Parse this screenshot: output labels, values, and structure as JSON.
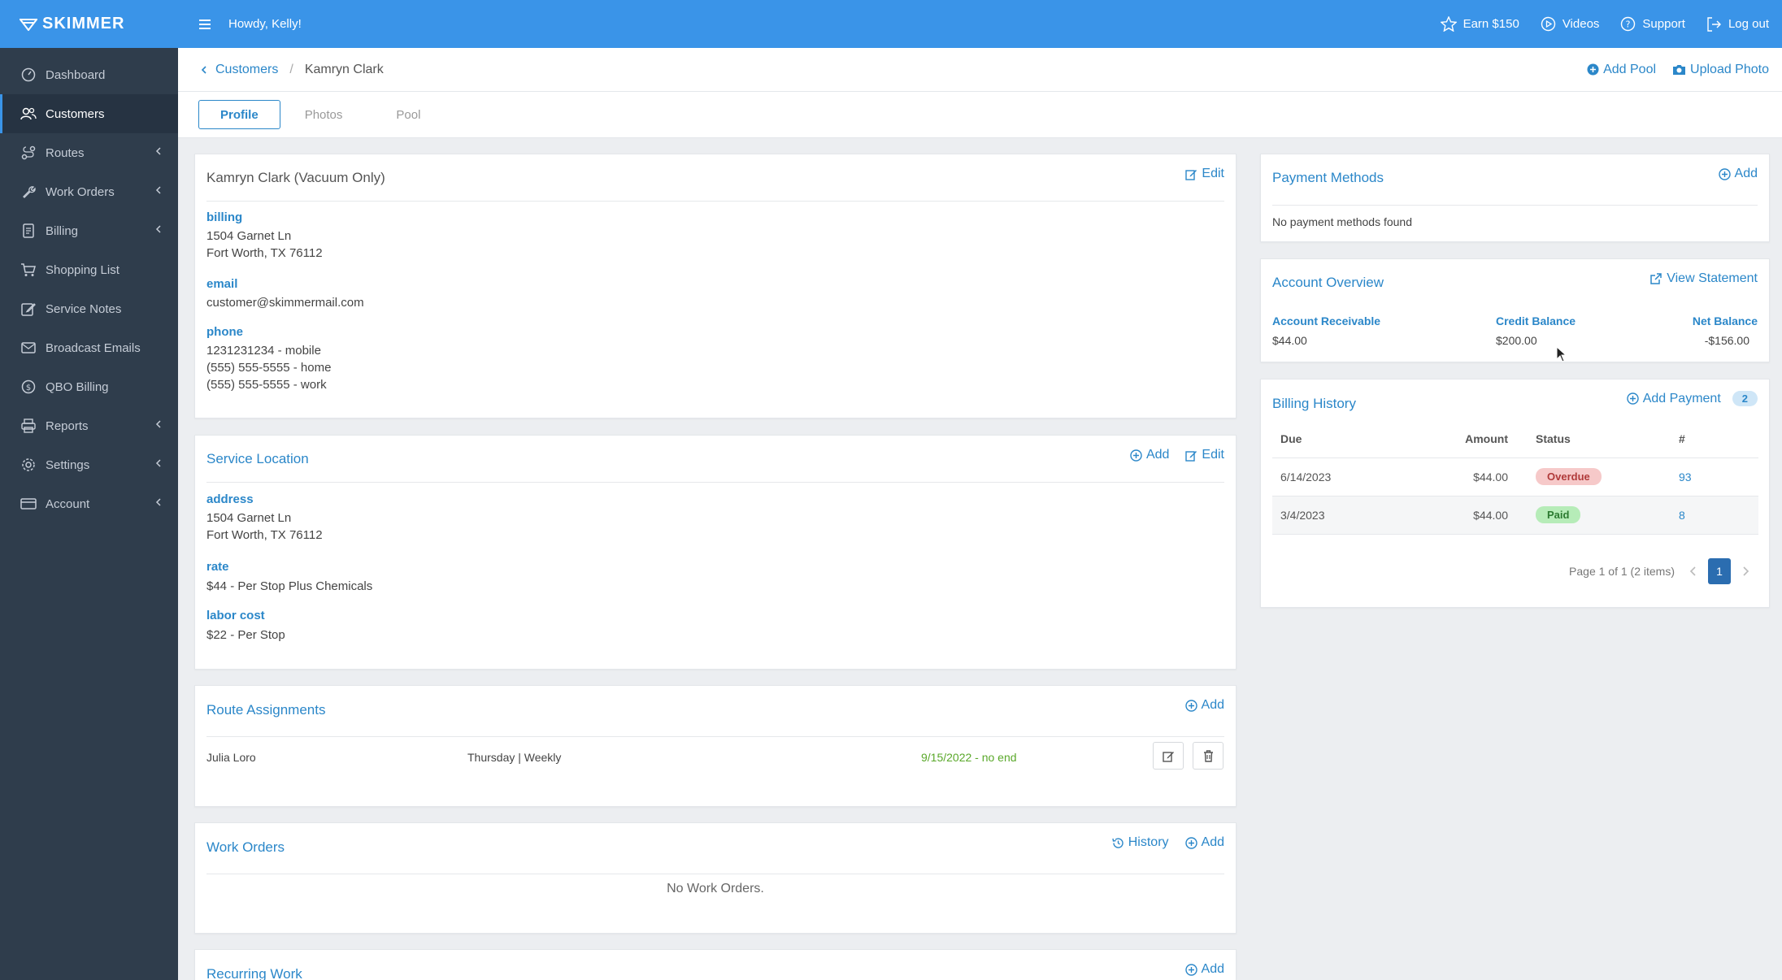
{
  "brand": "SKIMMER",
  "colors": {
    "primary": "#3a94e8",
    "sidebar": "#2f3d4c",
    "link": "#2b87c9",
    "overdue": "#f6c9c9",
    "paid": "#b6ecb8"
  },
  "sidebar": {
    "items": [
      {
        "label": "Dashboard",
        "icon": "dashboard-icon"
      },
      {
        "label": "Customers",
        "icon": "users-icon"
      },
      {
        "label": "Routes",
        "icon": "route-icon"
      },
      {
        "label": "Work Orders",
        "icon": "wrench-icon"
      },
      {
        "label": "Billing",
        "icon": "document-icon"
      },
      {
        "label": "Shopping List",
        "icon": "cart-icon"
      },
      {
        "label": "Service Notes",
        "icon": "note-icon"
      },
      {
        "label": "Broadcast Emails",
        "icon": "envelope-icon"
      },
      {
        "label": "QBO Billing",
        "icon": "dollar-icon"
      },
      {
        "label": "Reports",
        "icon": "printer-icon"
      },
      {
        "label": "Settings",
        "icon": "gear-icon"
      },
      {
        "label": "Account",
        "icon": "card-icon"
      }
    ]
  },
  "topbar": {
    "greeting": "Howdy, Kelly!",
    "earn": "Earn $150",
    "videos": "Videos",
    "support": "Support",
    "logout": "Log out"
  },
  "breadcrumb": {
    "parent": "Customers",
    "current": "Kamryn Clark"
  },
  "header_actions": {
    "add_pool": "Add Pool",
    "upload_photo": "Upload Photo"
  },
  "tabs": [
    "Profile",
    "Photos",
    "Pool"
  ],
  "profile": {
    "title": "Kamryn Clark (Vacuum Only)",
    "edit": "Edit",
    "billing_label": "billing",
    "billing_line1": "1504 Garnet Ln",
    "billing_line2": "Fort Worth, TX 76112",
    "email_label": "email",
    "email": "customer@skimmermail.com",
    "phone_label": "phone",
    "phone_mobile": "1231231234 - mobile",
    "phone_home": "(555) 555-5555 - home",
    "phone_work": "(555) 555-5555 - work"
  },
  "service_location": {
    "title": "Service Location",
    "add": "Add",
    "edit": "Edit",
    "address_label": "address",
    "address_line1": "1504 Garnet Ln",
    "address_line2": "Fort Worth, TX 76112",
    "rate_label": "rate",
    "rate": "$44 - Per Stop Plus Chemicals",
    "labor_label": "labor cost",
    "labor": "$22 - Per Stop"
  },
  "route_assignments": {
    "title": "Route Assignments",
    "add": "Add",
    "tech": "Julia Loro",
    "schedule": "Thursday | Weekly",
    "dates": "9/15/2022 - no end"
  },
  "work_orders": {
    "title": "Work Orders",
    "history": "History",
    "add": "Add",
    "empty": "No Work Orders."
  },
  "recurring_work": {
    "title": "Recurring Work",
    "add": "Add"
  },
  "payment_methods": {
    "title": "Payment Methods",
    "add": "Add",
    "empty": "No payment methods found"
  },
  "account_overview": {
    "title": "Account Overview",
    "view_statement": "View Statement",
    "receivable_label": "Account Receivable",
    "receivable": "$44.00",
    "credit_label": "Credit Balance",
    "credit": "$200.00",
    "net_label": "Net Balance",
    "net": "-$156.00"
  },
  "billing_history": {
    "title": "Billing History",
    "add_payment": "Add Payment",
    "count": "2",
    "headers": {
      "due": "Due",
      "amount": "Amount",
      "status": "Status",
      "num": "#"
    },
    "rows": [
      {
        "due": "6/14/2023",
        "amount": "$44.00",
        "status": "Overdue",
        "num": "93"
      },
      {
        "due": "3/4/2023",
        "amount": "$44.00",
        "status": "Paid",
        "num": "8"
      }
    ],
    "page_info": "Page 1 of 1 (2 items)",
    "page": "1"
  }
}
